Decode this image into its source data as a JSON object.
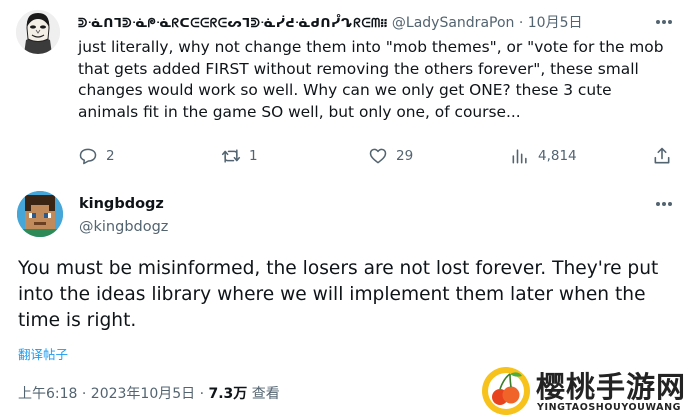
{
  "reply_tweet": {
    "display_name": "ᕲᓍᑎᒣᕲᓍᖘᓍᖇᑕᕮᕮᖇᕮᔕᒣᕲᓍᓰᕍᓍᑯᑎᓮᖊᖇᕮᗰ᎒᎒",
    "handle": "@LadySandraPon",
    "dot": "·",
    "date": "10月5日",
    "text": "just literally, why not change them into \"mob themes\", or \"vote for the mob that gets added FIRST without removing the others forever\", these small changes would work so well. Why can we only get ONE? these 3 cute animals fit in the game SO well, but only one, of course...",
    "replies": "2",
    "retweets": "1",
    "likes": "29",
    "views": "4,814"
  },
  "main_tweet": {
    "display_name": "kingbdogz",
    "handle": "@kingbdogz",
    "text": "You must be misinformed, the losers are not lost forever. They're put into the ideas library where we will implement them later when the time is right.",
    "translate_label": "翻译帖子",
    "time": "上午6:18 · 2023年10月5日 · ",
    "views_count": "7.3万",
    "views_label": " 查看"
  },
  "watermark": {
    "title": "樱桃手游网",
    "subtitle": "YINGTAOSHOUYOUWANG"
  },
  "colors": {
    "text": "#0f1419",
    "secondary": "#536471",
    "link": "#1d9bf0"
  },
  "icons": [
    "more-icon",
    "reply-icon",
    "retweet-icon",
    "like-icon",
    "views-icon",
    "share-icon",
    "cherry-logo"
  ]
}
